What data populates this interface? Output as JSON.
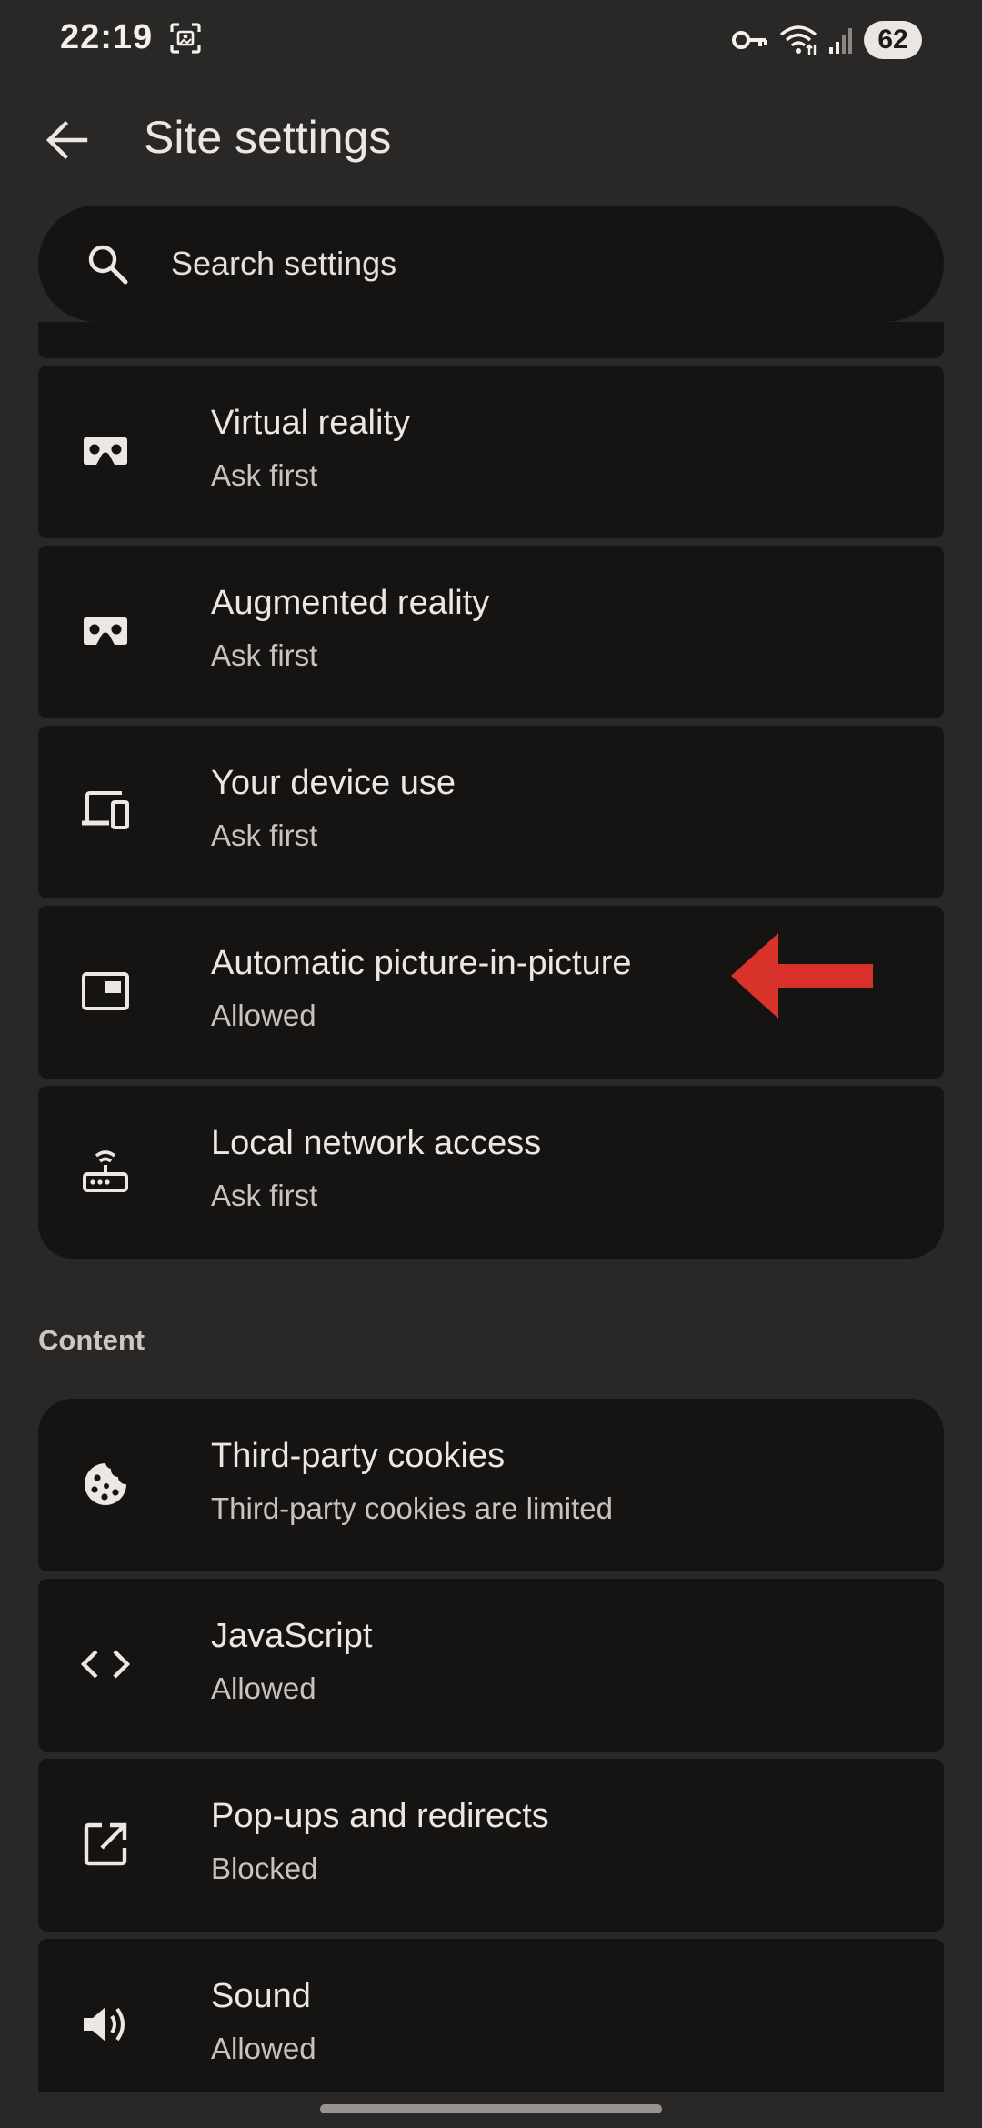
{
  "status_bar": {
    "time": "22:19",
    "battery": "62",
    "icons": [
      "screenshot-icon",
      "vpn-key-icon",
      "wifi-icon",
      "cell-signal-icon",
      "battery-icon"
    ]
  },
  "app_bar": {
    "title": "Site settings",
    "back_icon": "arrow-back-icon"
  },
  "search": {
    "placeholder": "Search settings",
    "value": ""
  },
  "permissions": [
    {
      "title": "Virtual reality",
      "subtitle": "Ask first",
      "icon": "vr-headset-icon"
    },
    {
      "title": "Augmented reality",
      "subtitle": "Ask first",
      "icon": "ar-headset-icon"
    },
    {
      "title": "Your device use",
      "subtitle": "Ask first",
      "icon": "devices-icon"
    },
    {
      "title": "Automatic picture-in-picture",
      "subtitle": "Allowed",
      "icon": "picture-in-picture-icon"
    },
    {
      "title": "Local network access",
      "subtitle": "Ask first",
      "icon": "router-icon"
    }
  ],
  "content_section": {
    "header": "Content",
    "items": [
      {
        "title": "Third-party cookies",
        "subtitle": "Third-party cookies are limited",
        "icon": "cookie-icon"
      },
      {
        "title": "JavaScript",
        "subtitle": "Allowed",
        "icon": "code-icon"
      },
      {
        "title": "Pop-ups and redirects",
        "subtitle": "Blocked",
        "icon": "open-in-new-icon"
      },
      {
        "title": "Sound",
        "subtitle": "Allowed",
        "icon": "volume-icon"
      }
    ]
  },
  "colors": {
    "background": "#2a2827",
    "card": "#161413",
    "text_primary": "#ece7e3",
    "text_secondary": "#c9c2bd",
    "annotation_arrow": "#d9322b"
  }
}
